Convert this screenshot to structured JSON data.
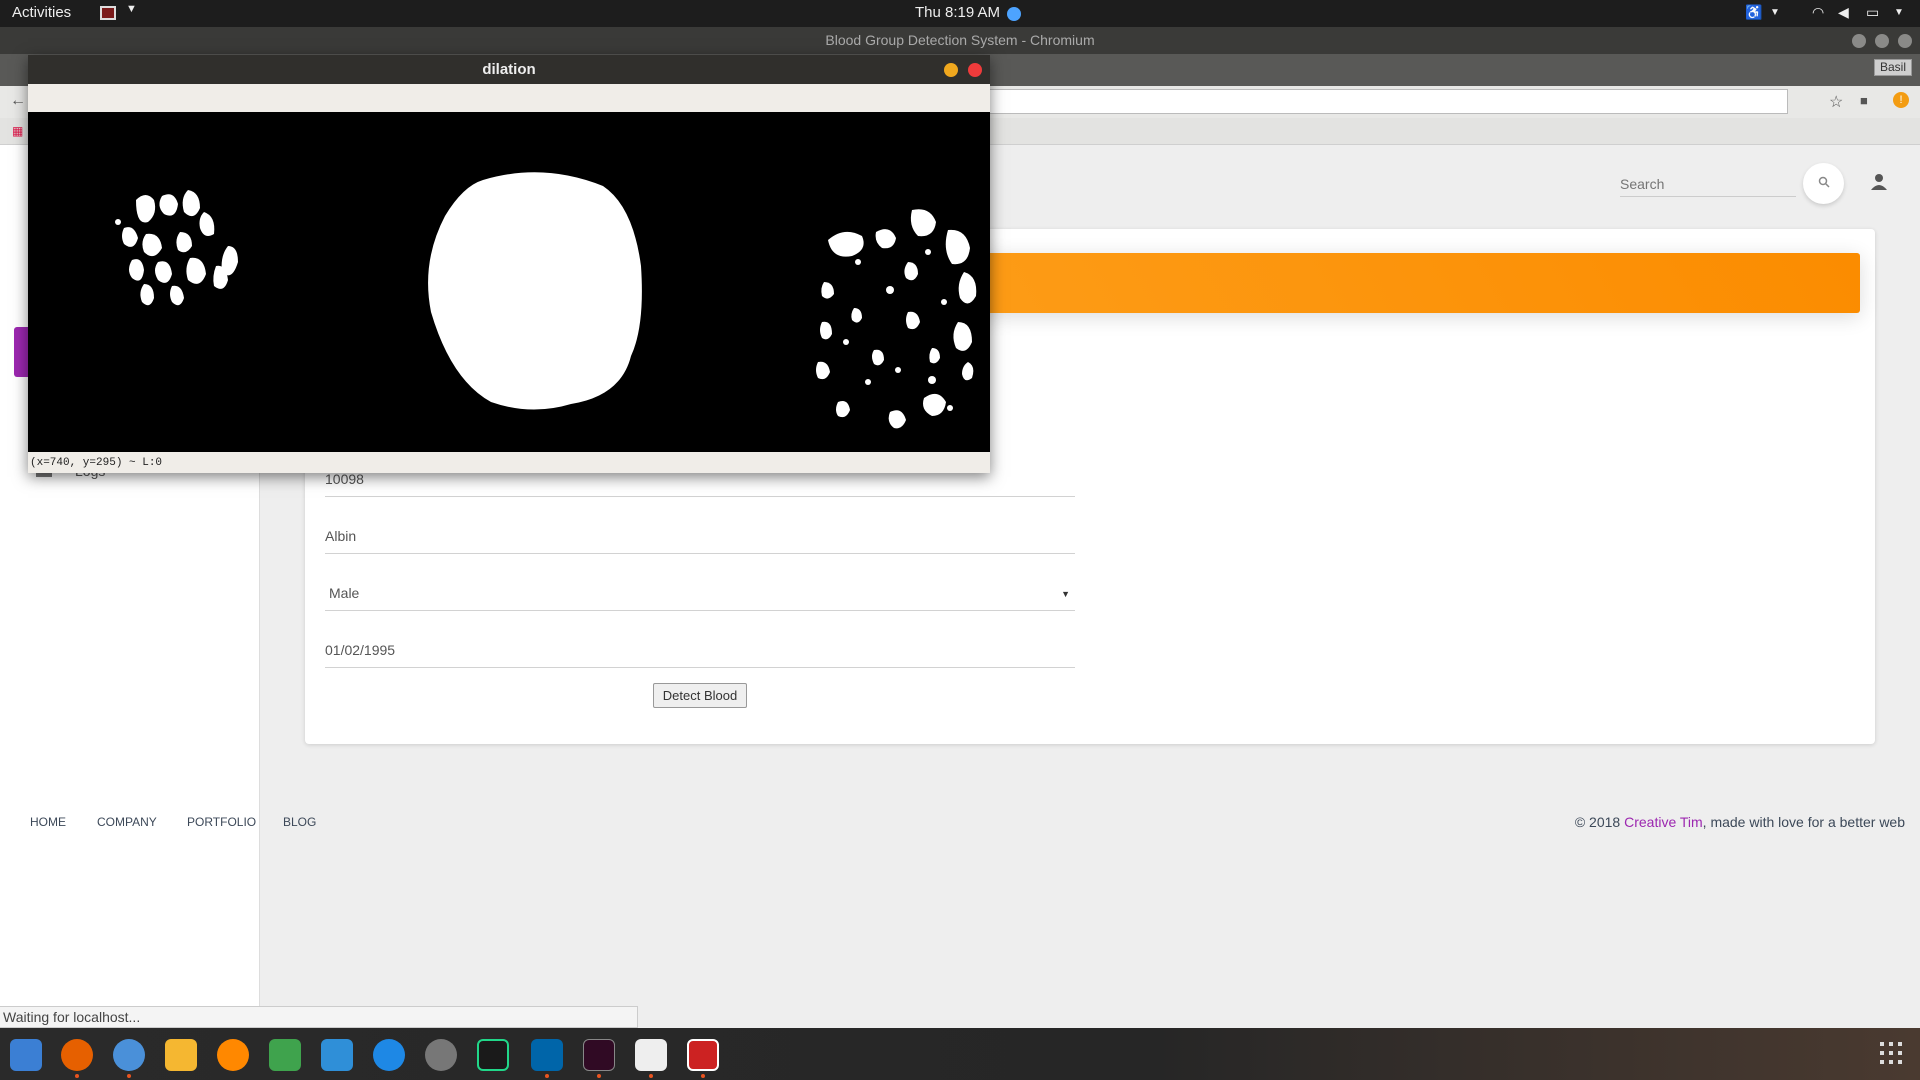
{
  "topbar": {
    "activities": "Activities",
    "clock": "Thu  8:19 AM"
  },
  "browser": {
    "window_title": "Blood Group Detection System - Chromium",
    "profile": "Basil"
  },
  "cv_window": {
    "title": "dilation",
    "status": "(x=740, y=295) ~ L:0"
  },
  "header": {
    "search_placeholder": "Search"
  },
  "sidebar": {
    "logs_label": "Logs"
  },
  "form": {
    "id_value": "10098",
    "name_value": "Albin",
    "gender_value": "Male",
    "dob_value": "01/02/1995",
    "submit_label": "Detect Blood"
  },
  "footer": {
    "links": [
      "HOME",
      "COMPANY",
      "PORTFOLIO",
      "BLOG"
    ],
    "copyright_prefix": "© 2018 ",
    "brand": "Creative Tim",
    "copyright_suffix": ", made with love for a better web"
  },
  "statusbar": {
    "text": "Waiting for localhost..."
  }
}
